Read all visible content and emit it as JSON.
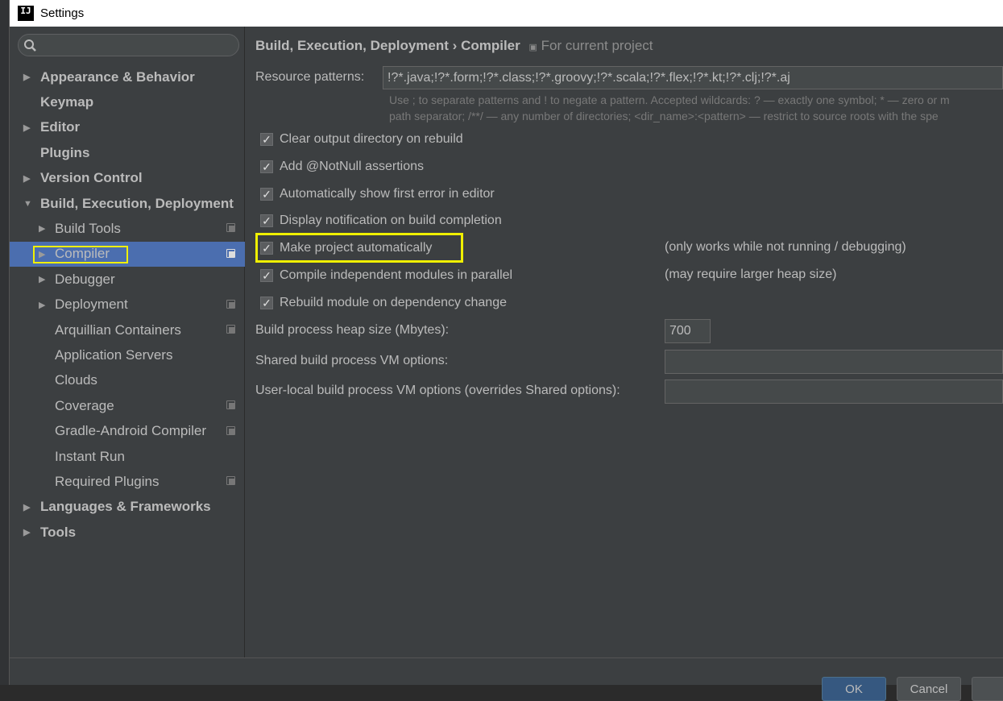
{
  "window": {
    "title": "Settings",
    "logo": "IJ"
  },
  "sidebar": {
    "search_placeholder": "",
    "items": [
      {
        "label": "Appearance & Behavior",
        "level": 0,
        "arrow": "▶",
        "shared": false
      },
      {
        "label": "Keymap",
        "level": 0,
        "arrow": "",
        "shared": false
      },
      {
        "label": "Editor",
        "level": 0,
        "arrow": "▶",
        "shared": false
      },
      {
        "label": "Plugins",
        "level": 0,
        "arrow": "",
        "shared": false
      },
      {
        "label": "Version Control",
        "level": 0,
        "arrow": "▶",
        "shared": false
      },
      {
        "label": "Build, Execution, Deployment",
        "level": 0,
        "arrow": "▼",
        "shared": false
      },
      {
        "label": "Build Tools",
        "level": 1,
        "arrow": "▶",
        "shared": true
      },
      {
        "label": "Compiler",
        "level": 1,
        "arrow": "▶",
        "shared": true,
        "selected": true
      },
      {
        "label": "Debugger",
        "level": 1,
        "arrow": "▶",
        "shared": false
      },
      {
        "label": "Deployment",
        "level": 1,
        "arrow": "▶",
        "shared": true
      },
      {
        "label": "Arquillian Containers",
        "level": 1,
        "arrow": "",
        "shared": true
      },
      {
        "label": "Application Servers",
        "level": 1,
        "arrow": "",
        "shared": false
      },
      {
        "label": "Clouds",
        "level": 1,
        "arrow": "",
        "shared": false
      },
      {
        "label": "Coverage",
        "level": 1,
        "arrow": "",
        "shared": true
      },
      {
        "label": "Gradle-Android Compiler",
        "level": 1,
        "arrow": "",
        "shared": true
      },
      {
        "label": "Instant Run",
        "level": 1,
        "arrow": "",
        "shared": false
      },
      {
        "label": "Required Plugins",
        "level": 1,
        "arrow": "",
        "shared": true
      },
      {
        "label": "Languages & Frameworks",
        "level": 0,
        "arrow": "▶",
        "shared": false
      },
      {
        "label": "Tools",
        "level": 0,
        "arrow": "▶",
        "shared": false
      }
    ]
  },
  "main": {
    "breadcrumb": {
      "parent": "Build, Execution, Deployment",
      "separator": "›",
      "current": "Compiler",
      "scope": "For current project"
    },
    "resource_patterns": {
      "label": "Resource patterns:",
      "value": "!?*.java;!?*.form;!?*.class;!?*.groovy;!?*.scala;!?*.flex;!?*.kt;!?*.clj;!?*.aj",
      "hint1": "Use ; to separate patterns and ! to negate a pattern. Accepted wildcards: ? — exactly one symbol; * — zero or m",
      "hint2": "path separator; /**/ — any number of directories;  <dir_name>:<pattern> — restrict to source roots with the spe"
    },
    "checkboxes": [
      {
        "label": "Clear output directory on rebuild",
        "checked": true,
        "note": ""
      },
      {
        "label": "Add @NotNull assertions",
        "checked": true,
        "note": ""
      },
      {
        "label": "Automatically show first error in editor",
        "checked": true,
        "note": ""
      },
      {
        "label": "Display notification on build completion",
        "checked": true,
        "note": ""
      },
      {
        "label": "Make project automatically",
        "checked": true,
        "note": "(only works while not running / debugging)"
      },
      {
        "label": "Compile independent modules in parallel",
        "checked": true,
        "note": "(may require larger heap size)"
      },
      {
        "label": "Rebuild module on dependency change",
        "checked": true,
        "note": ""
      }
    ],
    "heap": {
      "label": "Build process heap size (Mbytes):",
      "value": "700"
    },
    "shared_vm": {
      "label": "Shared build process VM options:",
      "value": ""
    },
    "user_vm": {
      "label": "User-local build process VM options (overrides Shared options):",
      "value": ""
    }
  },
  "footer": {
    "ok": "OK",
    "cancel": "Cancel"
  },
  "colors": {
    "background": "#3c3f41",
    "selection": "#4b6eaf",
    "highlight": "#f0f000"
  }
}
